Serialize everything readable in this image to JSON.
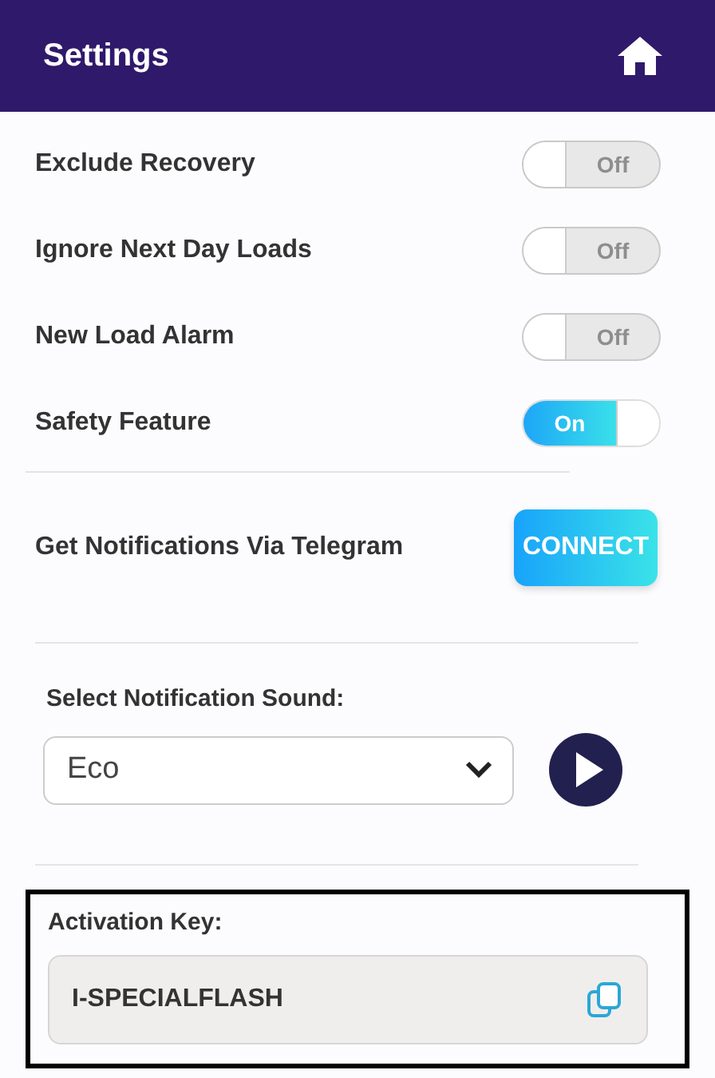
{
  "header": {
    "title": "Settings"
  },
  "toggles": [
    {
      "label": "Exclude Recovery",
      "on": false,
      "state_label": "Off"
    },
    {
      "label": "Ignore Next Day Loads",
      "on": false,
      "state_label": "Off"
    },
    {
      "label": "New Load Alarm",
      "on": false,
      "state_label": "Off"
    },
    {
      "label": "Safety Feature",
      "on": true,
      "state_label": "On"
    }
  ],
  "telegram": {
    "label": "Get Notifications Via Telegram",
    "button": "CONNECT"
  },
  "sound": {
    "label": "Select Notification Sound:",
    "value": "Eco"
  },
  "activation": {
    "label": "Activation Key:",
    "value": "I-SPECIALFLASH"
  }
}
